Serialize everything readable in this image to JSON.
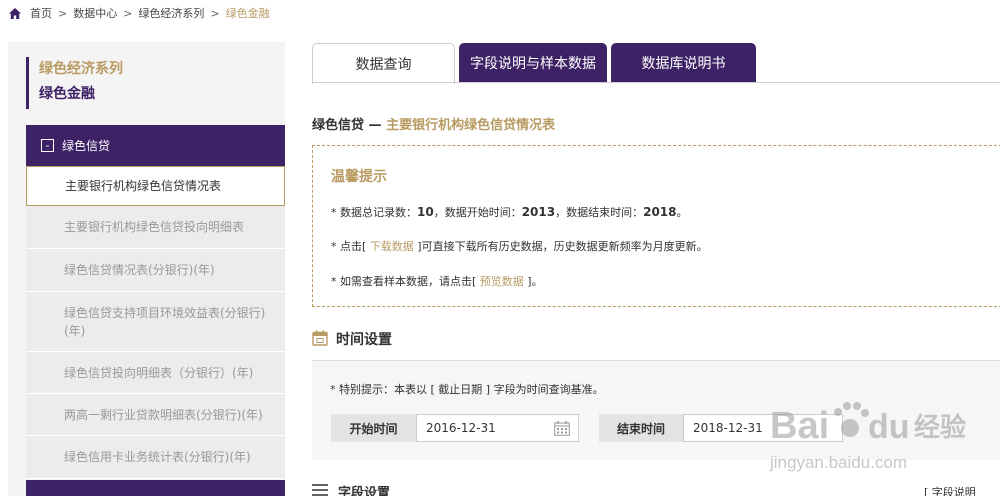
{
  "breadcrumb": {
    "items": [
      "首页",
      "数据中心",
      "绿色经济系列"
    ],
    "current": "绿色金融",
    "separator": ">"
  },
  "sidebar": {
    "series_title": "绿色经济系列",
    "subtitle": "绿色金融",
    "group": {
      "label": "绿色信贷",
      "toggle": "-"
    },
    "items": [
      {
        "label": "主要银行机构绿色信贷情况表",
        "active": true
      },
      {
        "label": "主要银行机构绿色信贷投向明细表",
        "active": false
      },
      {
        "label": "绿色信贷情况表(分银行)(年)",
        "active": false
      },
      {
        "label": "绿色信贷支持项目环境效益表(分银行)(年)",
        "active": false
      },
      {
        "label": "绿色信贷投向明细表（分银行）(年)",
        "active": false
      },
      {
        "label": "两高一剩行业贷款明细表(分银行)(年)",
        "active": false
      },
      {
        "label": "绿色信用卡业务统计表(分银行)(年)",
        "active": false
      }
    ]
  },
  "tabs": [
    {
      "label": "数据查询",
      "active": true
    },
    {
      "label": "字段说明与样本数据",
      "active": false
    },
    {
      "label": "数据库说明书",
      "active": false
    }
  ],
  "section": {
    "title_prefix": "绿色信贷 — ",
    "title_accent": "主要银行机构绿色信贷情况表"
  },
  "tips": {
    "title": "温馨提示",
    "line1_prefix": "* 数据总记录数：",
    "total_records": "10",
    "line1_mid1": "，数据开始时间：",
    "start_year": "2013",
    "line1_mid2": "，数据结束时间：",
    "end_year": "2018",
    "line1_suffix": "。",
    "line2_prefix": "* 点击[ ",
    "download_link": "下载数据",
    "line2_suffix": " ]可直接下载所有历史数据，历史数据更新频率为月度更新。",
    "line3_prefix": "* 如需查看样本数据，请点击[ ",
    "preview_link": "预览数据",
    "line3_suffix": " ]。"
  },
  "time_settings": {
    "title": "时间设置",
    "note": "* 特别提示：本表以 [ 截止日期 ] 字段为时间查询基准。",
    "start_label": "开始时间",
    "start_value": "2016-12-31",
    "end_label": "结束时间",
    "end_value": "2018-12-31"
  },
  "field_settings": {
    "title": "字段设置",
    "link": "[ 字段说明"
  },
  "watermark": {
    "brand": "Bai",
    "brand_suffix": "du",
    "cn": "经验",
    "url": "jingyan.baidu.com"
  },
  "colors": {
    "purple": "#3d2266",
    "gold": "#b89b62"
  }
}
